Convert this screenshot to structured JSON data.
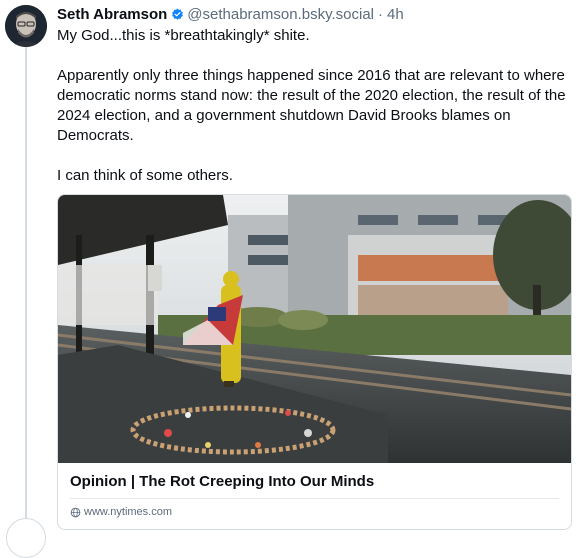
{
  "post": {
    "author_name": "Seth Abramson",
    "handle": "@sethabramson.bsky.social",
    "separator": "·",
    "time": "4h",
    "paragraphs": [
      "My God...this is *breathtakingly* shite.",
      "Apparently only three things happened since 2016 that are relevant to where democratic norms stand now: the result of the 2020 election, the result of the 2024 election, and a government shutdown David Brooks blames on Democrats.",
      "I can think of some others."
    ]
  },
  "embed": {
    "title": "Opinion | The Rot Creeping Into Our Minds",
    "domain": "www.nytimes.com"
  },
  "icons": {
    "verified": "verified-badge-icon",
    "globe": "globe-icon"
  },
  "colors": {
    "verified_blue": "#1083fe",
    "muted_text": "#5b6b7c",
    "border": "#d4dbe2"
  }
}
